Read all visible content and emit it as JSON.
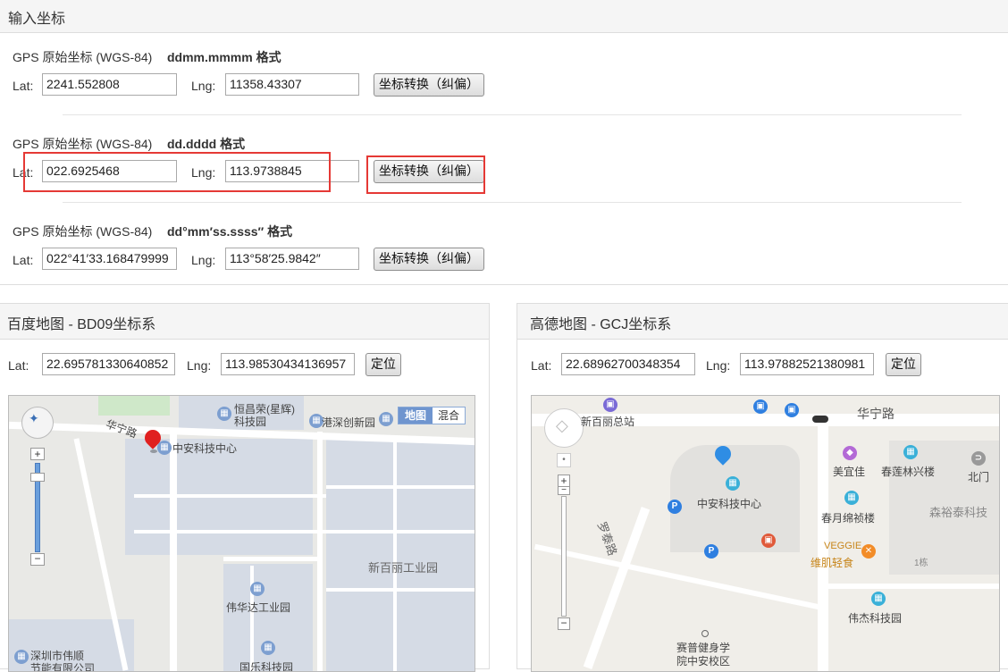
{
  "header": {
    "title": "输入坐标"
  },
  "section1": {
    "label": "GPS 原始坐标 (WGS-84)",
    "format": "ddmm.mmmm 格式",
    "lat_label": "Lat:",
    "lat_value": "2241.552808",
    "lng_label": "Lng:",
    "lng_value": "11358.43307",
    "button": "坐标转换（纠偏）"
  },
  "section2": {
    "label": "GPS 原始坐标 (WGS-84)",
    "format": "dd.dddd 格式",
    "lat_label": "Lat:",
    "lat_value": "022.6925468",
    "lng_label": "Lng:",
    "lng_value": "113.9738845",
    "button": "坐标转换（纠偏）"
  },
  "section3": {
    "label": "GPS 原始坐标 (WGS-84)",
    "format": "dd°mm′ss.ssss″ 格式",
    "lat_label": "Lat:",
    "lat_value": "022°41′33.168479999",
    "lng_label": "Lng:",
    "lng_value": "113°58′25.9842″",
    "button": "坐标转换（纠偏）"
  },
  "baidu": {
    "title": "百度地图 - BD09坐标系",
    "lat_label": "Lat:",
    "lat_value": "22.695781330640852",
    "lng_label": "Lng:",
    "lng_value": "113.98530434136957",
    "button": "定位",
    "map_type_map": "地图",
    "map_type_hybrid": "混合",
    "labels": {
      "road": "华宁路",
      "poi_center": "中安科技中心",
      "poi_hengchang": "恒昌荣(星辉)",
      "poi_hengchang2": "科技园",
      "poi_gangshen": "港深创新园",
      "poi_xinbaili": "新百丽工业园",
      "poi_weihuada": "伟华达工业园",
      "poi_shenzhen1": "深圳市伟顺",
      "poi_shenzhen2": "节能有限公司",
      "poi_guole": "国乐科技园"
    }
  },
  "gaode": {
    "title": "高德地图 - GCJ坐标系",
    "lat_label": "Lat:",
    "lat_value": "22.68962700348354",
    "lng_label": "Lng:",
    "lng_value": "113.97882521380981",
    "button": "定位",
    "labels": {
      "xinbaili": "新百丽总站",
      "road_huaning": "华宁路",
      "meiyijia": "美宜佳",
      "chunlian": "春莲林兴楼",
      "beimen": "北门",
      "center": "中安科技中心",
      "chunyue": "春月绵祯楼",
      "sentai": "森裕泰科技",
      "veggie": "VEGGIE",
      "weiji": "维肌轻食",
      "luotai": "罗泰路",
      "weijie": "伟杰科技园",
      "saipu1": "赛普健身学",
      "saipu2": "院中安校区",
      "yi": "1栋"
    }
  },
  "colors": {
    "highlight": "#e53935",
    "marker_baidu": "#e02020",
    "marker_gaode": "#2f8de4",
    "poi_blue": "#3b8fd8"
  }
}
